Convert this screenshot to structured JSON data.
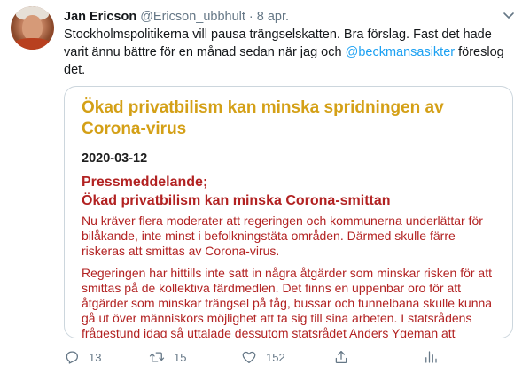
{
  "author": {
    "name": "Jan Ericson",
    "handle": "@Ericson_ubbhult",
    "separator": "·",
    "date": "8 apr."
  },
  "tweet": {
    "text_before_mention": "Stockholmspolitikerna vill pausa trängselskatten. Bra förslag. Fast det hade varit ännu bättre för en månad sedan när jag och ",
    "mention": "@beckmansasikter",
    "text_after_mention": " föreslog det."
  },
  "card": {
    "title": "Ökad privatbilism kan minska spridningen av Corona-virus",
    "date": "2020-03-12",
    "press_release_label": "Pressmeddelande;",
    "subtitle": "Ökad privatbilism kan minska Corona-smittan",
    "paragraph_1": "Nu kräver flera moderater att regeringen och kommunerna underlättar för bilåkande, inte minst i befolkningstäta områden. Därmed skulle färre riskeras att smittas av Corona-virus.",
    "paragraph_2": "Regeringen har hittills inte satt in några åtgärder som minskar risken för att smittas på de kollektiva färdmedlen. Det finns en uppenbar oro för att åtgärder som minskar trängsel på tåg, bussar och tunnelbana skulle kunna gå ut över människors möjlighet att ta sig till sina arbeten. I statsrådens frågestund idag så uttalade dessutom statsrådet Anders Ygeman att medarbetare som arbetar inom samhällskritiska funktioner ska undvika att åka kollektivtrafik för att"
  },
  "actions": {
    "reply_count": "13",
    "retweet_count": "15",
    "like_count": "152"
  },
  "icons": {
    "reply": "reply-icon",
    "retweet": "retweet-icon",
    "like": "heart-icon",
    "share": "share-icon",
    "analytics": "analytics-icon",
    "more": "chevron-down-icon"
  },
  "colors": {
    "link": "#1da1f2",
    "muted": "#657786",
    "doc_title": "#d4a017",
    "doc_red": "#b22222"
  }
}
